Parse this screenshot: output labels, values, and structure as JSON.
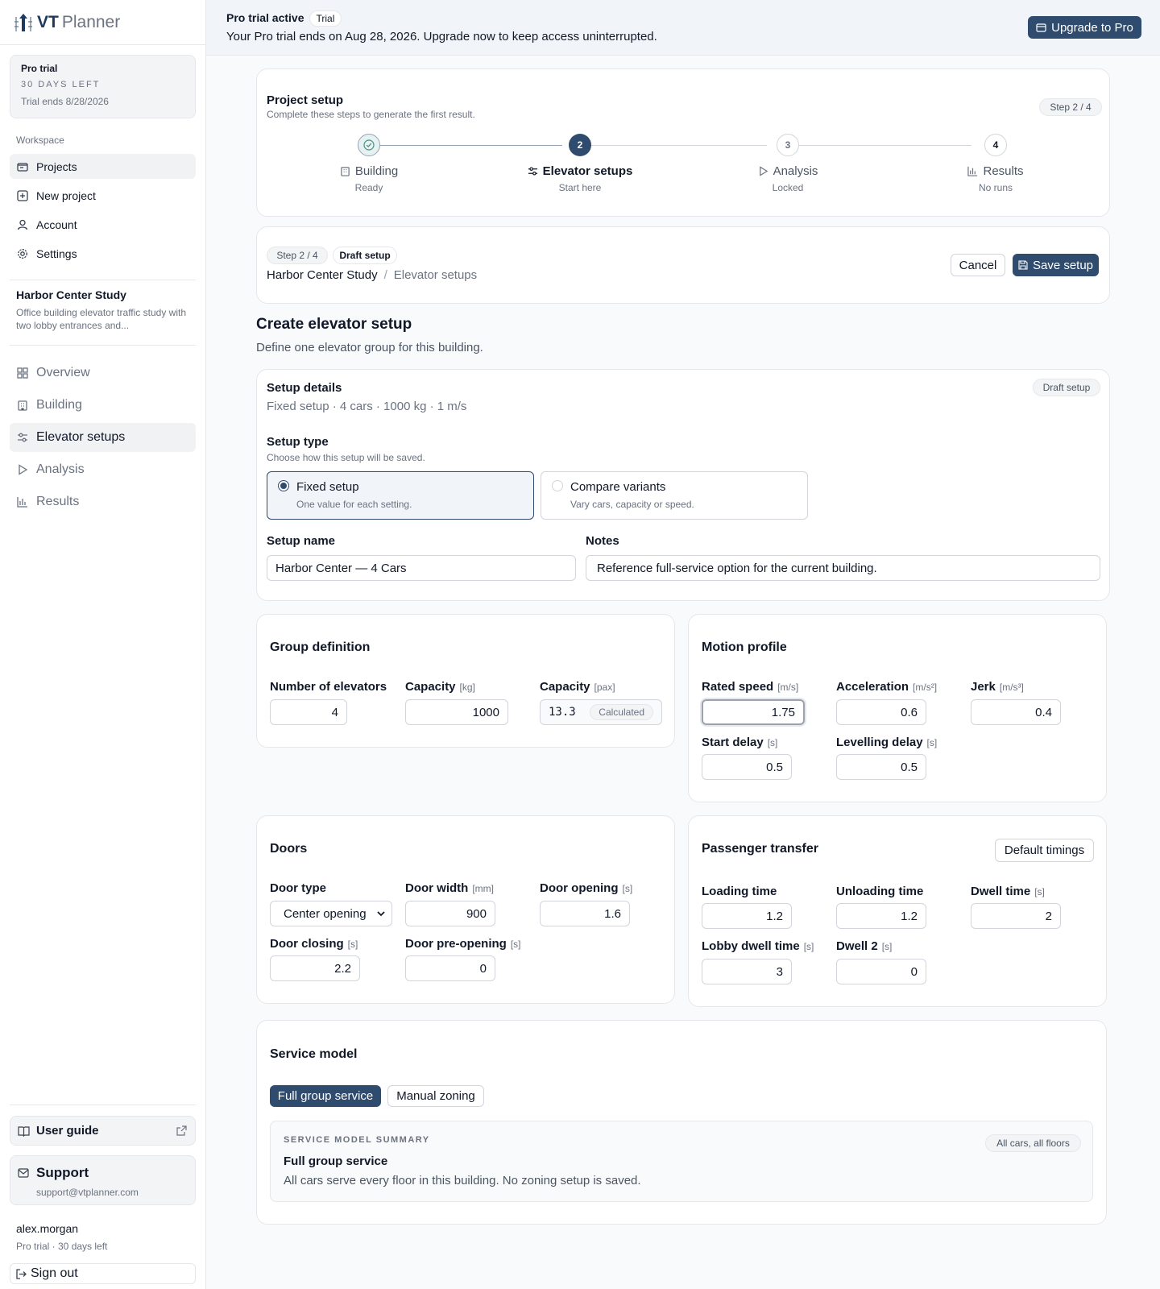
{
  "brand": {
    "name_bold": "VT",
    "name_rest": "Planner"
  },
  "trial": {
    "title": "Pro trial",
    "days_left": "30 DAYS LEFT",
    "ends": "Trial ends 8/28/2026"
  },
  "workspace": {
    "label": "Workspace",
    "items": [
      {
        "label": "Projects",
        "icon": "folder-icon"
      },
      {
        "label": "New project",
        "icon": "plus-square-icon"
      },
      {
        "label": "Account",
        "icon": "user-icon"
      },
      {
        "label": "Settings",
        "icon": "gear-icon"
      }
    ]
  },
  "project": {
    "name": "Harbor Center Study",
    "description": "Office building elevator traffic study with two lobby entrances and..."
  },
  "project_nav": [
    {
      "label": "Overview",
      "icon": "grid-icon"
    },
    {
      "label": "Building",
      "icon": "building-icon"
    },
    {
      "label": "Elevator setups",
      "icon": "sliders-icon"
    },
    {
      "label": "Analysis",
      "icon": "play-icon"
    },
    {
      "label": "Results",
      "icon": "bar-chart-icon"
    }
  ],
  "footer": {
    "guide": "User guide",
    "support_title": "Support",
    "support_email": "support@vtplanner.com",
    "user_name": "alex.morgan",
    "user_status": "Pro trial · 30 days left",
    "signout": "Sign out"
  },
  "banner": {
    "title": "Pro trial active",
    "badge": "Trial",
    "message": "Your Pro trial ends on Aug 28, 2026. Upgrade now to keep access uninterrupted.",
    "upgrade": "Upgrade to Pro"
  },
  "project_setup": {
    "title": "Project setup",
    "subtitle": "Complete these steps to generate the first result.",
    "badge": "Step 2 / 4",
    "steps": [
      {
        "num": "",
        "name": "Building",
        "status": "Ready",
        "icon": "building-icon"
      },
      {
        "num": "2",
        "name": "Elevator setups",
        "status": "Start here",
        "icon": "sliders-icon"
      },
      {
        "num": "3",
        "name": "Analysis",
        "status": "Locked",
        "icon": "play-icon"
      },
      {
        "num": "4",
        "name": "Results",
        "status": "No runs",
        "icon": "bar-chart-icon"
      }
    ]
  },
  "header_card": {
    "step_badge": "Step 2 / 4",
    "draft_badge": "Draft setup",
    "crumb_project": "Harbor Center Study",
    "crumb_sep": "/",
    "crumb_current": "Elevator setups",
    "cancel": "Cancel",
    "save": "Save setup"
  },
  "page": {
    "title": "Create elevator setup",
    "subtitle": "Define one elevator group for this building."
  },
  "details": {
    "title": "Setup details",
    "summary": "Fixed setup · 4 cars · 1000 kg · 1 m/s",
    "badge": "Draft setup",
    "type_label": "Setup type",
    "type_help": "Choose how this setup will be saved.",
    "options": [
      {
        "name": "Fixed setup",
        "desc": "One value for each setting.",
        "selected": true
      },
      {
        "name": "Compare variants",
        "desc": "Vary cars, capacity or speed.",
        "selected": false
      }
    ],
    "name_label": "Setup name",
    "name_value": "Harbor Center — 4 Cars",
    "notes_label": "Notes",
    "notes_value": "Reference full-service option for the current building."
  },
  "group": {
    "title": "Group definition",
    "elevators_label": "Number of elevators",
    "elevators_value": "4",
    "cap_kg_label": "Capacity",
    "cap_kg_unit": "[kg]",
    "cap_kg_value": "1000",
    "cap_pax_label": "Capacity",
    "cap_pax_unit": "[pax]",
    "cap_pax_value": "13.3",
    "cap_pax_tag": "Calculated"
  },
  "motion": {
    "title": "Motion profile",
    "speed_label": "Rated speed",
    "speed_unit": "[m/s]",
    "speed_value": "1.75",
    "accel_label": "Acceleration",
    "accel_unit": "[m/s²]",
    "accel_value": "0.6",
    "jerk_label": "Jerk",
    "jerk_unit": "[m/s³]",
    "jerk_value": "0.4",
    "start_label": "Start delay",
    "start_unit": "[s]",
    "start_value": "0.5",
    "level_label": "Levelling delay",
    "level_unit": "[s]",
    "level_value": "0.5"
  },
  "doors": {
    "title": "Doors",
    "type_label": "Door type",
    "type_value": "Center opening",
    "width_label": "Door width",
    "width_unit": "[mm]",
    "width_value": "900",
    "open_label": "Door opening",
    "open_unit": "[s]",
    "open_value": "1.6",
    "close_label": "Door closing",
    "close_unit": "[s]",
    "close_value": "2.2",
    "pre_label": "Door pre-opening",
    "pre_unit": "[s]",
    "pre_value": "0"
  },
  "transfer": {
    "title": "Passenger transfer",
    "defaults": "Default timings",
    "load_label": "Loading time",
    "load_value": "1.2",
    "unload_label": "Unloading time",
    "unload_value": "1.2",
    "dwell_label": "Dwell time",
    "dwell_unit": "[s]",
    "dwell_value": "2",
    "lobby_label": "Lobby dwell time",
    "lobby_unit": "[s]",
    "lobby_value": "3",
    "dwell2_label": "Dwell 2",
    "dwell2_unit": "[s]",
    "dwell2_value": "0"
  },
  "service": {
    "title": "Service model",
    "tab_full": "Full group service",
    "tab_manual": "Manual zoning",
    "summary_label": "SERVICE MODEL SUMMARY",
    "summary_badge": "All cars, all floors",
    "summary_title": "Full group service",
    "summary_text": "All cars serve every floor in this building. No zoning setup is saved."
  },
  "colors": {
    "accent": "#2f4b6e",
    "border": "#e5e7eb",
    "muted": "#6b7280"
  }
}
